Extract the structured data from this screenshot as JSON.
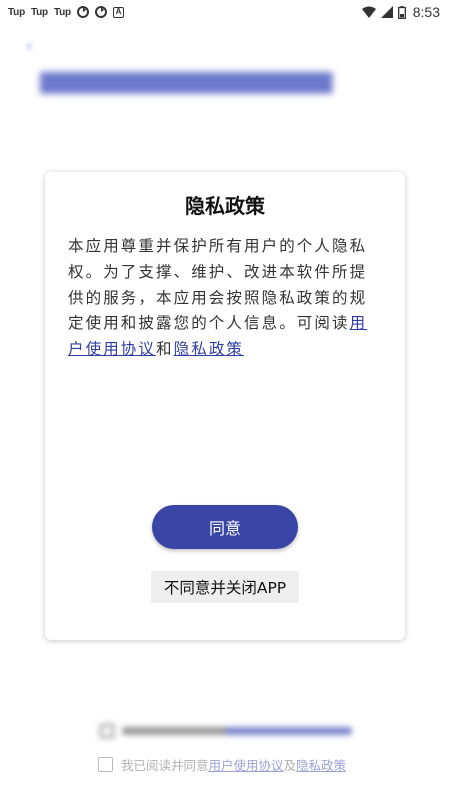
{
  "status_bar": {
    "notif_1": "Tup",
    "notif_2": "Tup",
    "notif_3": "Tup",
    "time": "8:53"
  },
  "dialog": {
    "title": "隐私政策",
    "body_text": "本应用尊重并保护所有用户的个人隐私权。为了支撑、维护、改进本软件所提供的服务，本应用会按照隐私政策的规定使用和披露您的个人信息。可阅读",
    "user_agreement_link": "用户使用协议",
    "and_text": "和",
    "privacy_policy_link": "隐私政策",
    "agree_label": "同意",
    "disagree_label": "不同意并关闭APP"
  },
  "consent": {
    "prefix": "我已阅读并同意",
    "user_agreement_link": "用户使用协议",
    "and_text": "及",
    "privacy_policy_link": "隐私政策"
  },
  "colors": {
    "accent": "#3a46a6",
    "link": "#2f3ea5"
  }
}
